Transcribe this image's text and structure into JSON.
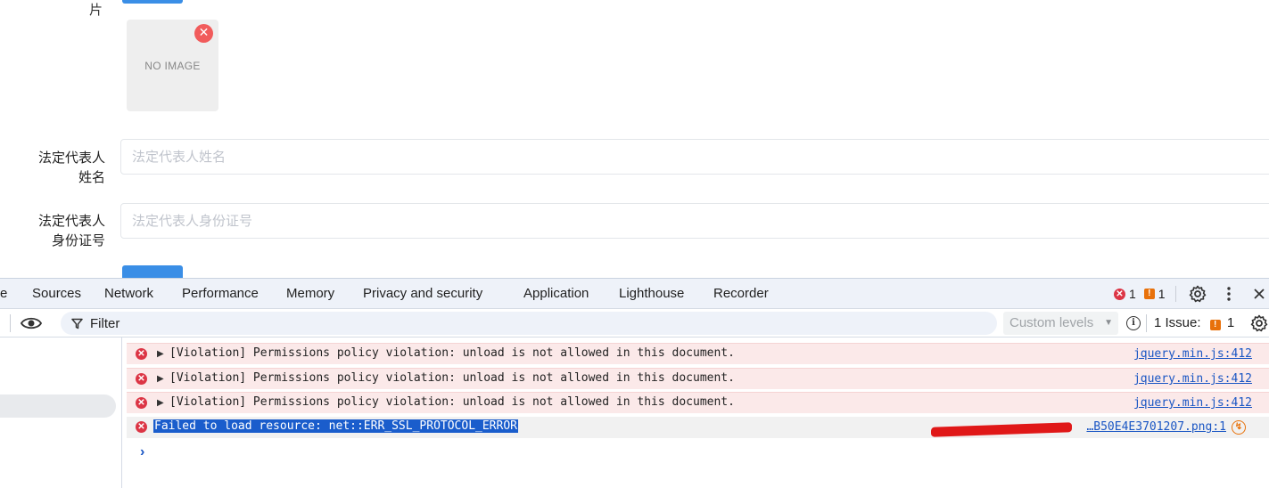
{
  "form": {
    "image_label": "片",
    "no_image": "NO IMAGE",
    "remove_glyph": "✕",
    "legal_rep_name_label": "法定代表人\n姓名",
    "legal_rep_name_placeholder": "法定代表人姓名",
    "legal_rep_id_label": "法定代表人\n身份证号",
    "legal_rep_id_placeholder": "法定代表人身份证号"
  },
  "devtools": {
    "tabs": [
      "e",
      "Sources",
      "Network",
      "Performance",
      "Memory",
      "Privacy and security",
      "Application",
      "Lighthouse",
      "Recorder"
    ],
    "error_count": "1",
    "warning_count": "1",
    "filter_placeholder": "Filter",
    "levels_label": "Custom levels",
    "issues_label": "1 Issue:",
    "issues_count": "1",
    "console_rows": [
      {
        "type": "error",
        "message": "[Violation] Permissions policy violation: unload is not allowed in this document.",
        "source": "jquery.min.js:412"
      },
      {
        "type": "error",
        "message": "[Violation] Permissions policy violation: unload is not allowed in this document.",
        "source": "jquery.min.js:412"
      },
      {
        "type": "error",
        "message": "[Violation] Permissions policy violation: unload is not allowed in this document.",
        "source": "jquery.min.js:412"
      },
      {
        "type": "error",
        "message": "Failed to load resource: net::ERR_SSL_PROTOCOL_ERROR",
        "source": "…B50E4E3701207.png:1"
      }
    ],
    "prompt_glyph": "›"
  },
  "colors": {
    "accent_button": "#3a8ee6",
    "error_red": "#dc3545",
    "warning_orange": "#e8710a",
    "link_blue": "#1a56c4",
    "selection_blue": "#1a5dcc"
  },
  "icons": [
    "remove-image-icon",
    "error-icon",
    "warning-icon",
    "settings-icon",
    "more-icon",
    "close-icon",
    "eye-icon",
    "filter-icon",
    "info-icon",
    "network-request-icon",
    "expand-triangle-icon",
    "prompt-chevron-icon"
  ]
}
